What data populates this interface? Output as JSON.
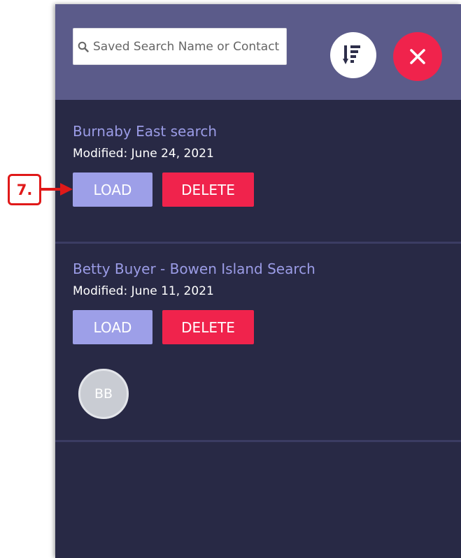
{
  "search": {
    "placeholder": "Saved Search Name or Contact"
  },
  "header": {
    "sort_icon": "sort-descending-icon",
    "close_icon": "close-icon"
  },
  "saved_searches": [
    {
      "title": "Burnaby East search",
      "modified": "Modified: June 24, 2021",
      "load_label": "LOAD",
      "delete_label": "DELETE"
    },
    {
      "title": "Betty Buyer - Bowen Island Search",
      "modified": "Modified: June 11, 2021",
      "load_label": "LOAD",
      "delete_label": "DELETE",
      "contact_initials": "BB"
    }
  ],
  "annotation": {
    "step_label": "7."
  },
  "colors": {
    "header_bg": "#5b5b8a",
    "panel_bg": "#282945",
    "accent_purple": "#9d9fe8",
    "danger_red": "#f0234c",
    "annotation_red": "#e01919"
  }
}
